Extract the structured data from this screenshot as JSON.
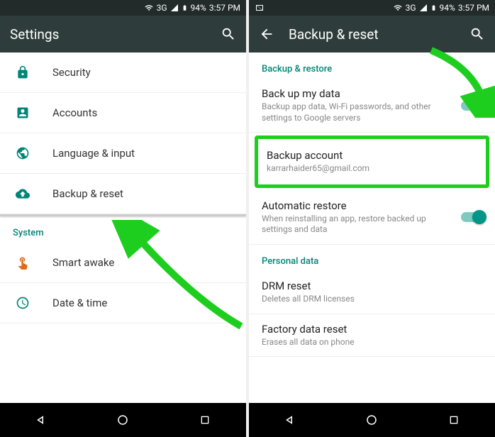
{
  "left": {
    "status": {
      "network": "3G",
      "battery": "94%",
      "time": "3:57 PM"
    },
    "header": {
      "title": "Settings"
    },
    "items": [
      {
        "icon": "lock-icon",
        "label": "Security"
      },
      {
        "icon": "account-icon",
        "label": "Accounts"
      },
      {
        "icon": "globe-icon",
        "label": "Language & input"
      },
      {
        "icon": "cloud-up-icon",
        "label": "Backup & reset"
      }
    ],
    "section": "System",
    "items2": [
      {
        "icon": "hand-icon",
        "label": "Smart awake"
      },
      {
        "icon": "clock-icon",
        "label": "Date & time"
      }
    ]
  },
  "right": {
    "status": {
      "network": "3G",
      "battery": "94%",
      "time": "3:57 PM"
    },
    "header": {
      "title": "Backup & reset"
    },
    "section1": "Backup & restore",
    "backup_data": {
      "title": "Back up my data",
      "sub": "Backup app data, Wi-Fi passwords, and other settings to Google servers"
    },
    "backup_account": {
      "title": "Backup account",
      "sub": "karrarhaider65@gmail.com"
    },
    "auto_restore": {
      "title": "Automatic restore",
      "sub": "When reinstalling an app, restore backed up settings and data"
    },
    "section2": "Personal data",
    "drm": {
      "title": "DRM reset",
      "sub": "Deletes all DRM licenses"
    },
    "factory": {
      "title": "Factory data reset",
      "sub": "Erases all data on phone"
    }
  }
}
